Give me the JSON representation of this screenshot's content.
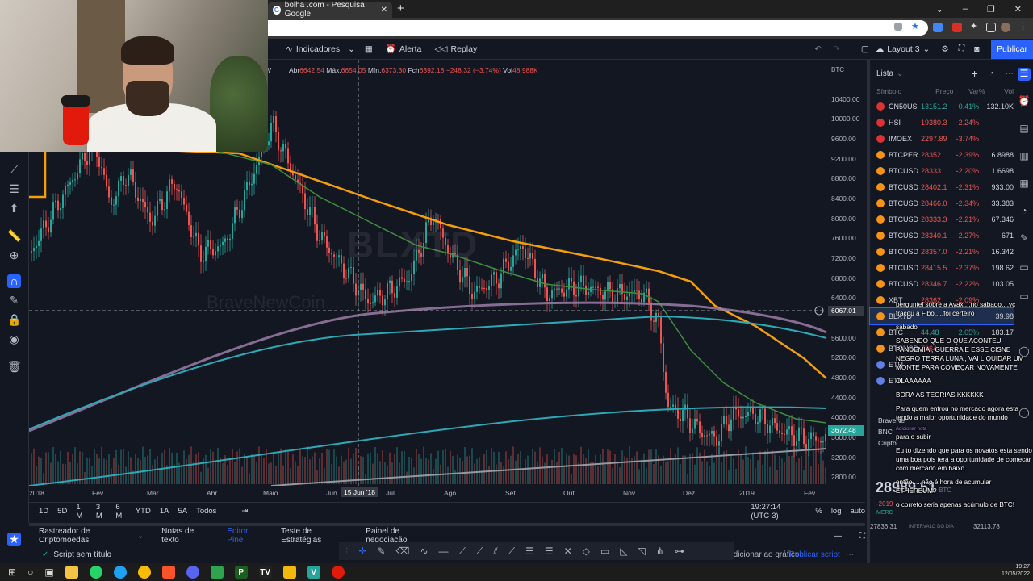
{
  "browser": {
    "tab_title": "bolha .com - Pesquisa Google",
    "tab_favicon": "G"
  },
  "toolbar": {
    "indicators": "Indicadores",
    "alert": "Alerta",
    "replay": "Replay",
    "layout": "Layout 3",
    "publish": "Publicar"
  },
  "legend": {
    "interval": "W",
    "open_label": "Abr",
    "open": "6642.54",
    "high_label": "Máx.",
    "high": "6654.05",
    "low_label": "Mín.",
    "low": "6373.30",
    "close_label": "Fch",
    "close": "6392.18",
    "change": "−248.32 (−3.74%)",
    "vol_label": "Vol",
    "vol": "48.988K"
  },
  "watermark": {
    "symbol": "BLXTD",
    "source": "BraveNewCoin..."
  },
  "price_axis": {
    "currency": "BTC",
    "labels": [
      "10400.00",
      "10000.00",
      "9600.00",
      "9200.00",
      "8800.00",
      "8400.00",
      "8000.00",
      "7600.00",
      "7200.00",
      "6800.00",
      "6400.00",
      "5600.00",
      "5200.00",
      "4800.00",
      "4400.00",
      "4000.00",
      "3600.00",
      "3200.00",
      "2800.00"
    ],
    "crosshair_price": "6067.01",
    "last_price": "3672.48"
  },
  "time_axis": {
    "labels": [
      "2018",
      "Fev",
      "Mar",
      "Abr",
      "Maio",
      "Jun",
      "Jul",
      "Ago",
      "Set",
      "Out",
      "Nov",
      "Dez",
      "2019",
      "Fev"
    ],
    "crosshair_date": "15 Jun '18"
  },
  "ranges": [
    "1D",
    "5D",
    "1 M",
    "3 M",
    "6 M",
    "YTD",
    "1A",
    "5A",
    "Todos"
  ],
  "status": {
    "time": "19:27:14 (UTC-3)",
    "pct": "%",
    "log": "log",
    "auto": "auto"
  },
  "bottom_tabs": [
    "Rastreador de Criptomoedas",
    "Notas de texto",
    "Editor Pine",
    "Teste de Estratégias",
    "Painel de negociação"
  ],
  "editor": {
    "script_title": "Script sem título",
    "add_to_chart": "Adicionar ao gráfico",
    "publish_script": "Publicar script"
  },
  "watchlist": {
    "title": "Lista",
    "col_symbol": "Símbolo",
    "col_price": "Preço",
    "col_change": "Var%",
    "col_vol": "Vol",
    "rows": [
      {
        "sym": "CN50USD",
        "price": "13151.2",
        "chg": "0.41%",
        "vol": "132.10K",
        "dot": "#e03131",
        "dir": "pos"
      },
      {
        "sym": "HSI",
        "price": "19380.3",
        "chg": "-2.24%",
        "vol": "",
        "dot": "#e03131",
        "dir": "neg"
      },
      {
        "sym": "IMOEX",
        "price": "2297.89",
        "chg": "-3.74%",
        "vol": "",
        "dot": "#e03131",
        "dir": "neg"
      },
      {
        "sym": "BTCPERP",
        "price": "28352",
        "chg": "-2.39%",
        "vol": "6.8988",
        "dot": "#f7931a",
        "dir": "neg"
      },
      {
        "sym": "BTCUSD",
        "price": "28333",
        "chg": "-2.20%",
        "vol": "1.6698",
        "dot": "#f7931a",
        "dir": "neg"
      },
      {
        "sym": "BTCUSD",
        "price": "28402.1",
        "chg": "-2.31%",
        "vol": "933.00",
        "dot": "#f7931a",
        "dir": "neg"
      },
      {
        "sym": "BTCUSD",
        "price": "28466.0",
        "chg": "-2.34%",
        "vol": "33.383",
        "dot": "#f7931a",
        "dir": "neg"
      },
      {
        "sym": "BTCUSD",
        "price": "28333.3",
        "chg": "-2.21%",
        "vol": "67.346",
        "dot": "#f7931a",
        "dir": "neg"
      },
      {
        "sym": "BTCUSD",
        "price": "28340.1",
        "chg": "-2.27%",
        "vol": "671",
        "dot": "#f7931a",
        "dir": "neg"
      },
      {
        "sym": "BTCUSD",
        "price": "28357.0",
        "chg": "-2.21%",
        "vol": "16.342",
        "dot": "#f7931a",
        "dir": "neg"
      },
      {
        "sym": "BTCUSD",
        "price": "28415.5",
        "chg": "-2.37%",
        "vol": "198.62",
        "dot": "#f7931a",
        "dir": "neg"
      },
      {
        "sym": "BTCUSD",
        "price": "28346.7",
        "chg": "-2.22%",
        "vol": "103.05",
        "dot": "#f7931a",
        "dir": "neg"
      },
      {
        "sym": "XBT",
        "price": "28362",
        "chg": "-2.09%",
        "vol": "",
        "dot": "#f7931a",
        "dir": "neg"
      },
      {
        "sym": "BLXTD",
        "price": "",
        "chg": "",
        "vol": "39.98",
        "dot": "#f7931a",
        "dir": "neg"
      },
      {
        "sym": "BTC",
        "price": "44.48",
        "chg": "2.05%",
        "vol": "183.17",
        "dot": "#f7931a",
        "dir": "pos"
      },
      {
        "sym": "BTCUSD",
        "price": "7264",
        "chg": "",
        "vol": "",
        "dot": "#f7931a",
        "dir": "neg"
      },
      {
        "sym": "ETH",
        "price": "",
        "chg": "",
        "vol": "",
        "dot": "#627eea",
        "dir": "neg"
      },
      {
        "sym": "ETH",
        "price": "",
        "chg": "",
        "vol": "",
        "dot": "#627eea",
        "dir": "neg"
      }
    ],
    "detail": {
      "name": "BraveNe",
      "exchange": "BNC",
      "type": "Cripto",
      "price": "28989.51",
      "currency": "BTC",
      "change": "-2019",
      "mercado": "MERC",
      "range_low": "27836.31",
      "range_label": "INTERVALO DO DIA",
      "range_high": "32113.78"
    }
  },
  "chat": [
    {
      "user": "",
      "text": "perguntei sobre a Avax....no sábado....vc traçou a Fibo.....foi certeiro"
    },
    {
      "user": "",
      "text": "sábado"
    },
    {
      "user": "",
      "text": "SABENDO QUE O QUE ACONTEU PANDEMIA , GUERRA E ESSE CISNE NEGRO TERRA LUNA , VAI LIQUIDAR UM MONTE PARA COMEÇAR NOVAMENTE"
    },
    {
      "user": "",
      "text": "OLAAAAAA"
    },
    {
      "user": "",
      "text": "BORA AS TEORIAS KKKKKK"
    },
    {
      "user": "",
      "text": "Para quem entrou no mercado agora esta tendo a maior oportunidade do mundo"
    },
    {
      "user": "Adicionar nota",
      "text": "para o subir"
    },
    {
      "user": "",
      "text": "Eu to dizendo que para os novatos esta sendo uma boa pois terá a oportunidade de comecar com mercado em baixo."
    },
    {
      "user": "",
      "text": "então.....não é hora de acumular ETHEREUM?"
    },
    {
      "user": "",
      "text": "o correto seria apenas acúmulo de BTC!"
    }
  ],
  "clock": {
    "time": "19:27",
    "date": "12/05/2022"
  },
  "colors": {
    "bg": "#131722",
    "up": "#26a69a",
    "down": "#ef5350",
    "orange": "#f59e0b",
    "green_line": "#3f8f3f",
    "purple": "#9c7ba8",
    "teal": "#2fa8b5",
    "accent": "#2962ff"
  }
}
